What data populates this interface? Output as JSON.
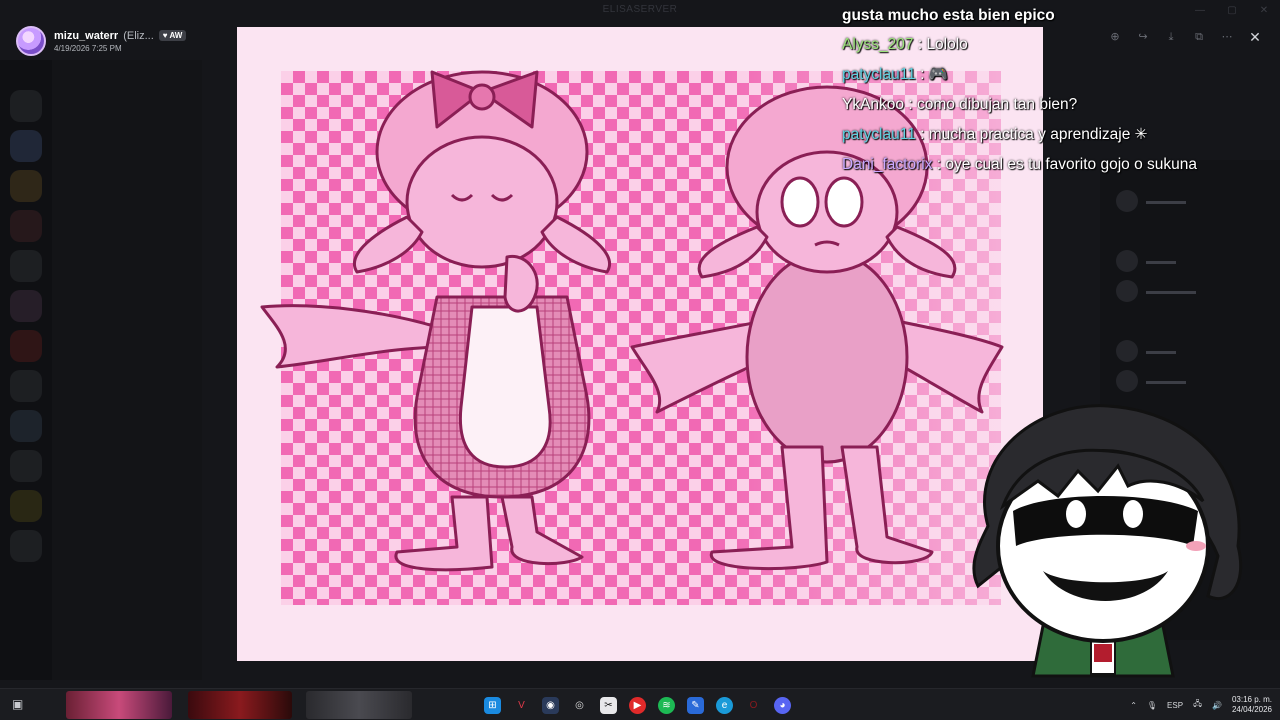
{
  "window": {
    "title": "ELISASERVER"
  },
  "viewer": {
    "username": "mizu_waterr",
    "display_name": "(Eliz...",
    "badge": "AW",
    "timestamp": "4/19/2026 7:25 PM",
    "tools": [
      "zoom-icon",
      "forward-icon",
      "download-icon",
      "open-external-icon",
      "more-icon",
      "close-icon"
    ]
  },
  "chat": [
    {
      "nick": "",
      "message": "gusta mucho esta bien epico",
      "nick_color": "#ffffff"
    },
    {
      "nick": "Alyss_207",
      "message": "Lololo",
      "nick_color": "#9be37a"
    },
    {
      "nick": "patyclau11",
      "message": "🎮",
      "nick_color": "#5fd1e0"
    },
    {
      "nick": "YkAnkoo",
      "message": "como dibujan tan bien?",
      "nick_color": "#ffffff"
    },
    {
      "nick": "patyclau11",
      "message": "mucha practica y aprendizaje ✳",
      "nick_color": "#5fd1e0"
    },
    {
      "nick": "Dani_factorix",
      "message": "oye cual es tu favorito gojo o sukuna",
      "nick_color": "#c9a8ff"
    }
  ],
  "tray": {
    "language": "ESP",
    "time": "03:16 p. m.",
    "date": "24/04/2026"
  },
  "colors": {
    "check_dark": "#f169b4",
    "check_light": "#fbd0e8",
    "frame": "#fbe4f2",
    "character_fill": "#f6b6da",
    "line": "#8a1f55"
  }
}
